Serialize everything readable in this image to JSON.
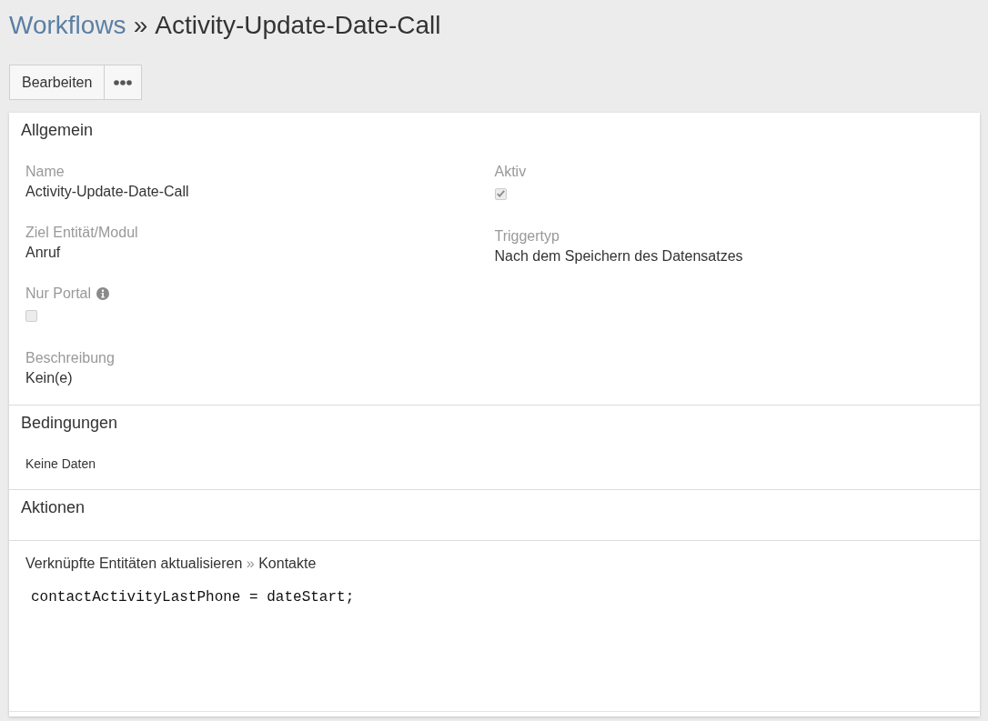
{
  "breadcrumb": {
    "parent": "Workflows",
    "separator": "»",
    "current": "Activity-Update-Date-Call"
  },
  "buttons": [
    {
      "kind": "text",
      "label": "Bearbeiten"
    },
    {
      "kind": "more"
    }
  ],
  "panels": [
    {
      "kind": "fields",
      "title": "Allgemein",
      "columns": [
        [
          {
            "kind": "text",
            "label": "Name",
            "value": "Activity-Update-Date-Call"
          },
          {
            "kind": "text",
            "label": "Ziel Entität/Modul",
            "value": "Anruf"
          },
          {
            "kind": "checkbox",
            "label": "Nur Portal",
            "info": true,
            "checked": false,
            "disabled": true
          },
          {
            "kind": "text",
            "label": "Beschreibung",
            "value": "Kein(e)"
          }
        ],
        [
          {
            "kind": "checkbox",
            "label": "Aktiv",
            "checked": true,
            "disabled": true
          },
          {
            "kind": "text",
            "label": "Triggertyp",
            "value": "Nach dem Speichern des Datensatzes"
          }
        ]
      ]
    },
    {
      "kind": "empty",
      "title": "Bedingungen",
      "message": "Keine Daten"
    },
    {
      "kind": "actions",
      "title": "Aktionen",
      "actions": [
        {
          "type": "Verknüpfte Entitäten aktualisieren",
          "separator": "»",
          "target": "Kontakte",
          "code": "contactActivityLastPhone = dateStart;"
        }
      ]
    }
  ]
}
